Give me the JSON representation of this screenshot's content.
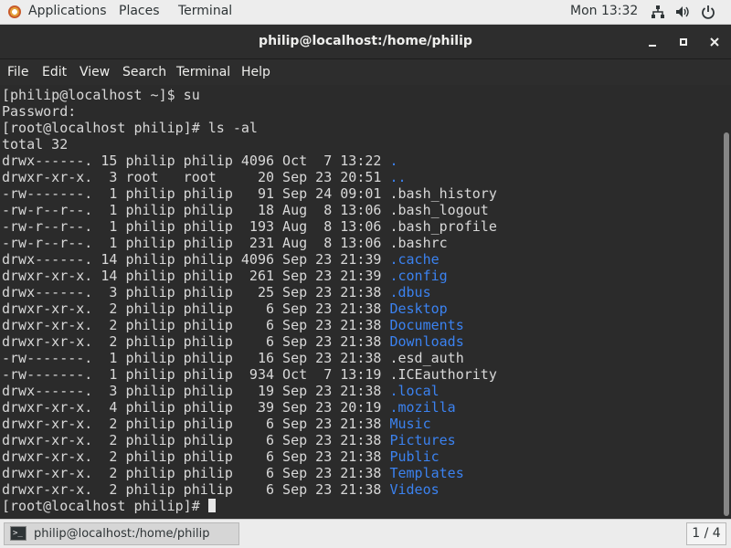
{
  "topbar": {
    "applications": "Applications",
    "places": "Places",
    "terminal": "Terminal",
    "clock": "Mon 13:32",
    "icons": [
      "network-icon",
      "volume-icon",
      "power-icon"
    ]
  },
  "window": {
    "title": "philip@localhost:/home/philip",
    "controls": [
      "minimize",
      "maximize",
      "close"
    ]
  },
  "menubar": [
    "File",
    "Edit",
    "View",
    "Search",
    "Terminal",
    "Help"
  ],
  "terminal": {
    "lines": [
      "[philip@localhost ~]$ su",
      "Password:",
      "[root@localhost philip]# ls -al",
      "total 32",
      "drwx------. 15 philip philip 4096 Oct  7 13:22 ",
      "drwxr-xr-x.  3 root   root     20 Sep 23 20:51 ",
      "-rw-------.  1 philip philip   91 Sep 24 09:01 ",
      "-rw-r--r--.  1 philip philip   18 Aug  8 13:06 ",
      "-rw-r--r--.  1 philip philip  193 Aug  8 13:06 ",
      "-rw-r--r--.  1 philip philip  231 Aug  8 13:06 ",
      "drwx------. 14 philip philip 4096 Sep 23 21:39 ",
      "drwxr-xr-x. 14 philip philip  261 Sep 23 21:39 ",
      "drwx------.  3 philip philip   25 Sep 23 21:38 ",
      "drwxr-xr-x.  2 philip philip    6 Sep 23 21:38 ",
      "drwxr-xr-x.  2 philip philip    6 Sep 23 21:38 ",
      "drwxr-xr-x.  2 philip philip    6 Sep 23 21:38 ",
      "-rw-------.  1 philip philip   16 Sep 23 21:38 ",
      "-rw-------.  1 philip philip  934 Oct  7 13:19 ",
      "drwx------.  3 philip philip   19 Sep 23 21:38 ",
      "drwxr-xr-x.  4 philip philip   39 Sep 23 20:19 ",
      "drwxr-xr-x.  2 philip philip    6 Sep 23 21:38 ",
      "drwxr-xr-x.  2 philip philip    6 Sep 23 21:38 ",
      "drwxr-xr-x.  2 philip philip    6 Sep 23 21:38 ",
      "drwxr-xr-x.  2 philip philip    6 Sep 23 21:38 ",
      "drwxr-xr-x.  2 philip philip    6 Sep 23 21:38 ",
      "[root@localhost philip]# "
    ],
    "names": [
      "",
      "",
      "",
      "",
      ".",
      "..",
      ".bash_history",
      ".bash_logout",
      ".bash_profile",
      ".bashrc",
      ".cache",
      ".config",
      ".dbus",
      "Desktop",
      "Documents",
      "Downloads",
      ".esd_auth",
      ".ICEauthority",
      ".local",
      ".mozilla",
      "Music",
      "Pictures",
      "Public",
      "Templates",
      "Videos",
      ""
    ],
    "name_is_dir": [
      false,
      false,
      false,
      false,
      true,
      true,
      false,
      false,
      false,
      false,
      true,
      true,
      true,
      true,
      true,
      true,
      false,
      false,
      true,
      true,
      true,
      true,
      true,
      true,
      true,
      false
    ],
    "colors": {
      "foreground": "#d8d8d8",
      "background": "#2b2b2b",
      "directory": "#3b82f0"
    }
  },
  "taskbar": {
    "task_label": "philip@localhost:/home/philip",
    "workspace": "1 / 4"
  }
}
